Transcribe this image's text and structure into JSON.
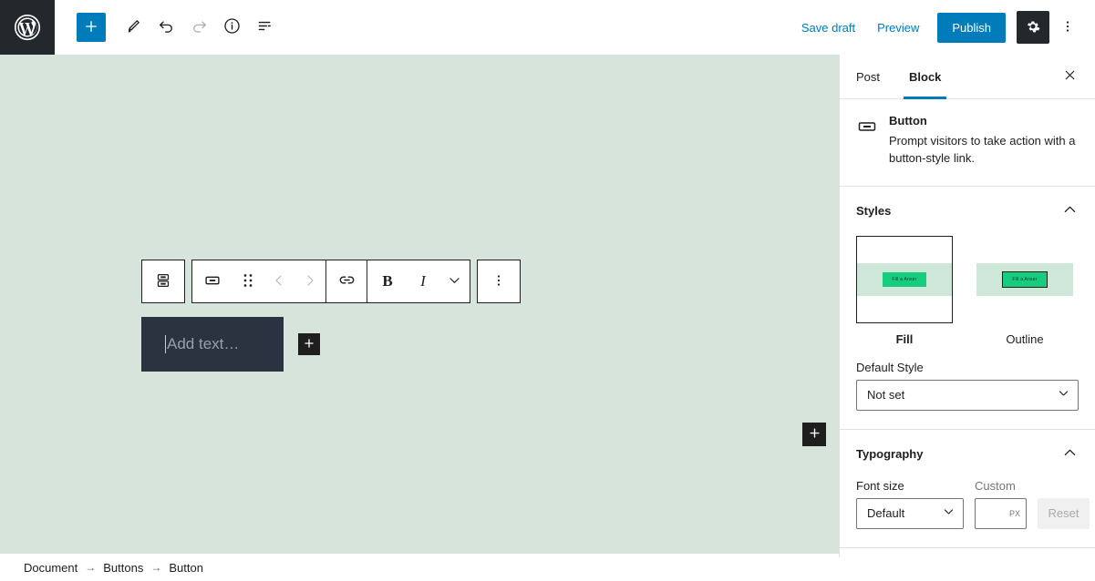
{
  "topbar": {
    "logo_icon": "wordpress-logo-icon",
    "add_block_label": "+",
    "add_block_icon": "plus-icon",
    "edit_icon": "pencil-icon",
    "undo_icon": "undo-arrow-icon",
    "redo_icon": "redo-arrow-icon",
    "info_icon": "info-circle-icon",
    "list_view_icon": "list-view-icon",
    "save_draft_label": "Save draft",
    "preview_label": "Preview",
    "publish_label": "Publish",
    "settings_icon": "gear-icon",
    "more_icon": "kebab-menu-icon",
    "accent_color": "#007cba",
    "dark_color": "#23282d"
  },
  "canvas": {
    "background_color": "#d6e4dc",
    "block_toolbar": {
      "parent_block_icon": "buttons-block-icon",
      "block_type_icon": "button-block-icon",
      "drag_handle_icon": "drag-handle-icon",
      "move_up_icon": "chevron-left-icon",
      "move_down_icon": "chevron-right-icon",
      "link_icon": "link-icon",
      "bold_label": "B",
      "italic_label": "I",
      "more_rich_text_icon": "chevron-down-icon",
      "options_icon": "kebab-menu-icon"
    },
    "button_block": {
      "placeholder": "Add text…",
      "background_color": "#2b3240",
      "has_caret": true
    },
    "inline_appender_icon": "plus-icon",
    "corner_appender_icon": "plus-icon"
  },
  "breadcrumb": {
    "items": [
      {
        "label": "Document"
      },
      {
        "label": "Buttons"
      },
      {
        "label": "Button"
      }
    ],
    "separator": "→"
  },
  "sidebar": {
    "tabs": [
      {
        "label": "Post",
        "active": false
      },
      {
        "label": "Block",
        "active": true
      }
    ],
    "close_icon": "close-icon",
    "block_card": {
      "icon": "button-block-icon",
      "title": "Button",
      "description": "Prompt visitors to take action with a button-style link."
    },
    "styles_panel": {
      "title": "Styles",
      "collapse_icon": "chevron-up-icon",
      "options": [
        {
          "label": "Fill",
          "selected": true,
          "preview_text": "Fill a Anser",
          "preview_outlined": false
        },
        {
          "label": "Outline",
          "selected": false,
          "preview_text": "Fill a Anser",
          "preview_outlined": true
        }
      ],
      "default_style_label": "Default Style",
      "default_style_value": "Not set",
      "select_chevron_icon": "chevron-down-icon"
    },
    "typography_panel": {
      "title": "Typography",
      "collapse_icon": "chevron-up-icon",
      "font_size_label": "Font size",
      "font_size_value": "Default",
      "custom_label": "Custom",
      "custom_value": "",
      "custom_unit": "PX",
      "reset_label": "Reset",
      "select_chevron_icon": "chevron-down-icon"
    }
  }
}
